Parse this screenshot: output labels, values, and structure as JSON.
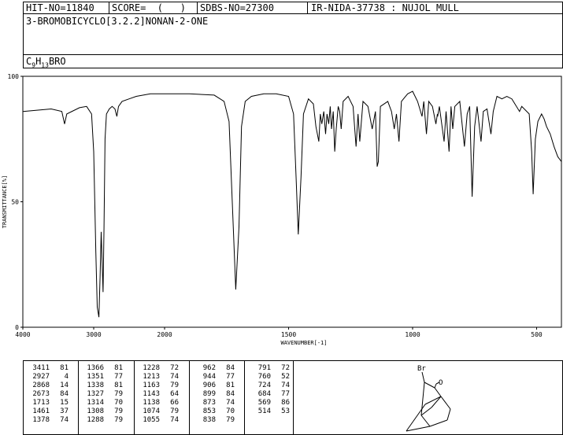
{
  "header": {
    "hit_no": "HIT-NO=11840",
    "score": "SCORE=  (   )",
    "sdbs_no": "SDBS-NO=27300",
    "ir_info": "IR-NIDA-37738 : NUJOL MULL",
    "compound_name": "3-BROMOBICYCLO[3.2.2]NONAN-2-ONE",
    "formula_c": "C",
    "formula_c_sub": "9",
    "formula_h": "H",
    "formula_h_sub": "13",
    "formula_rest": "BRO"
  },
  "chart_data": {
    "type": "line",
    "xlabel": "WAVENUMBER[-1]",
    "ylabel": "TRANSMITTANCE[%]",
    "xlim": [
      4000,
      400
    ],
    "ylim": [
      0,
      100
    ],
    "x_ticks": [
      "4000",
      "3000",
      "2000",
      "1500",
      "1000",
      "500"
    ],
    "y_ticks": [
      "0",
      "50",
      "100"
    ],
    "series": [
      {
        "points": [
          [
            4000,
            86
          ],
          [
            3800,
            86.5
          ],
          [
            3600,
            87
          ],
          [
            3450,
            86
          ],
          [
            3411,
            81
          ],
          [
            3380,
            85
          ],
          [
            3200,
            87.5
          ],
          [
            3100,
            88
          ],
          [
            3030,
            85
          ],
          [
            3000,
            70
          ],
          [
            2970,
            30
          ],
          [
            2950,
            8
          ],
          [
            2927,
            4
          ],
          [
            2910,
            20
          ],
          [
            2895,
            38
          ],
          [
            2880,
            25
          ],
          [
            2868,
            14
          ],
          [
            2855,
            40
          ],
          [
            2840,
            75
          ],
          [
            2820,
            85
          ],
          [
            2780,
            87
          ],
          [
            2740,
            88
          ],
          [
            2700,
            87
          ],
          [
            2673,
            84
          ],
          [
            2650,
            88
          ],
          [
            2600,
            90
          ],
          [
            2500,
            91
          ],
          [
            2400,
            92
          ],
          [
            2300,
            92.5
          ],
          [
            2200,
            93
          ],
          [
            2100,
            93
          ],
          [
            2000,
            93
          ],
          [
            1900,
            93
          ],
          [
            1800,
            92.5
          ],
          [
            1760,
            90
          ],
          [
            1740,
            82
          ],
          [
            1725,
            45
          ],
          [
            1713,
            15
          ],
          [
            1700,
            40
          ],
          [
            1690,
            80
          ],
          [
            1675,
            90
          ],
          [
            1650,
            92
          ],
          [
            1600,
            93
          ],
          [
            1550,
            93
          ],
          [
            1500,
            92
          ],
          [
            1480,
            85
          ],
          [
            1470,
            60
          ],
          [
            1461,
            37
          ],
          [
            1450,
            60
          ],
          [
            1440,
            85
          ],
          [
            1420,
            91
          ],
          [
            1400,
            89
          ],
          [
            1390,
            80
          ],
          [
            1378,
            74
          ],
          [
            1372,
            85
          ],
          [
            1366,
            81
          ],
          [
            1358,
            86
          ],
          [
            1351,
            77
          ],
          [
            1345,
            85
          ],
          [
            1338,
            81
          ],
          [
            1332,
            88
          ],
          [
            1327,
            79
          ],
          [
            1320,
            86
          ],
          [
            1314,
            70
          ],
          [
            1308,
            79
          ],
          [
            1300,
            88
          ],
          [
            1294,
            86
          ],
          [
            1288,
            79
          ],
          [
            1280,
            90
          ],
          [
            1260,
            92
          ],
          [
            1240,
            88
          ],
          [
            1228,
            72
          ],
          [
            1220,
            85
          ],
          [
            1213,
            74
          ],
          [
            1200,
            90
          ],
          [
            1180,
            88
          ],
          [
            1163,
            79
          ],
          [
            1150,
            86
          ],
          [
            1143,
            64
          ],
          [
            1138,
            66
          ],
          [
            1130,
            88
          ],
          [
            1100,
            90
          ],
          [
            1085,
            86
          ],
          [
            1074,
            79
          ],
          [
            1065,
            85
          ],
          [
            1055,
            74
          ],
          [
            1045,
            90
          ],
          [
            1020,
            93
          ],
          [
            1000,
            94
          ],
          [
            980,
            90
          ],
          [
            962,
            84
          ],
          [
            955,
            90
          ],
          [
            944,
            77
          ],
          [
            935,
            90
          ],
          [
            920,
            88
          ],
          [
            906,
            81
          ],
          [
            900,
            85
          ],
          [
            899,
            84
          ],
          [
            892,
            88
          ],
          [
            873,
            74
          ],
          [
            865,
            86
          ],
          [
            853,
            70
          ],
          [
            845,
            88
          ],
          [
            838,
            79
          ],
          [
            830,
            88
          ],
          [
            810,
            90
          ],
          [
            791,
            72
          ],
          [
            780,
            85
          ],
          [
            770,
            88
          ],
          [
            760,
            52
          ],
          [
            750,
            80
          ],
          [
            740,
            88
          ],
          [
            724,
            74
          ],
          [
            715,
            86
          ],
          [
            700,
            87
          ],
          [
            684,
            77
          ],
          [
            675,
            86
          ],
          [
            660,
            92
          ],
          [
            640,
            91
          ],
          [
            620,
            92
          ],
          [
            600,
            91
          ],
          [
            569,
            86
          ],
          [
            560,
            88
          ],
          [
            530,
            85
          ],
          [
            520,
            70
          ],
          [
            514,
            53
          ],
          [
            505,
            75
          ],
          [
            495,
            82
          ],
          [
            480,
            85
          ],
          [
            470,
            83
          ],
          [
            460,
            80
          ],
          [
            445,
            77
          ],
          [
            430,
            72
          ],
          [
            415,
            68
          ],
          [
            400,
            66
          ]
        ]
      }
    ]
  },
  "peaks": [
    [
      [
        "3411",
        "81"
      ],
      [
        "2927",
        "4"
      ],
      [
        "2868",
        "14"
      ],
      [
        "2673",
        "84"
      ],
      [
        "1713",
        "15"
      ],
      [
        "1461",
        "37"
      ],
      [
        "1378",
        "74"
      ]
    ],
    [
      [
        "1366",
        "81"
      ],
      [
        "1351",
        "77"
      ],
      [
        "1338",
        "81"
      ],
      [
        "1327",
        "79"
      ],
      [
        "1314",
        "70"
      ],
      [
        "1308",
        "79"
      ],
      [
        "1288",
        "79"
      ]
    ],
    [
      [
        "1228",
        "72"
      ],
      [
        "1213",
        "74"
      ],
      [
        "1163",
        "79"
      ],
      [
        "1143",
        "64"
      ],
      [
        "1138",
        "66"
      ],
      [
        "1074",
        "79"
      ],
      [
        "1055",
        "74"
      ]
    ],
    [
      [
        "962",
        "84"
      ],
      [
        "944",
        "77"
      ],
      [
        "906",
        "81"
      ],
      [
        "899",
        "84"
      ],
      [
        "873",
        "74"
      ],
      [
        "853",
        "70"
      ],
      [
        "838",
        "79"
      ]
    ],
    [
      [
        "791",
        "72"
      ],
      [
        "760",
        "52"
      ],
      [
        "724",
        "74"
      ],
      [
        "684",
        "77"
      ],
      [
        "569",
        "86"
      ],
      [
        "514",
        "53"
      ]
    ]
  ],
  "structure": {
    "br_label": "Br",
    "o_label": "O"
  }
}
